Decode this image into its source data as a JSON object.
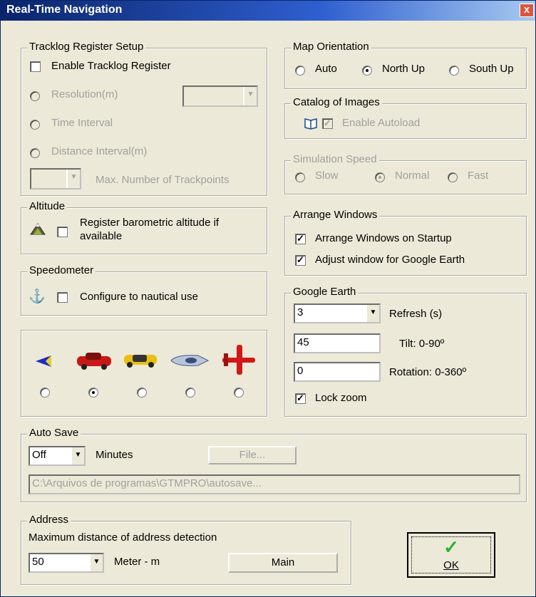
{
  "window": {
    "title": "Real-Time Navigation",
    "close_glyph": "x"
  },
  "tracklog": {
    "legend": "Tracklog Register Setup",
    "enable_label": "Enable Tracklog Register",
    "enable_checked": false,
    "resolution_label": "Resolution(m)",
    "time_interval_label": "Time Interval",
    "distance_interval_label": "Distance Interval(m)",
    "max_points_label": "Max. Number of Trackpoints"
  },
  "altitude": {
    "legend": "Altitude",
    "icon": "mountain-icon",
    "label_line1": "Register barometric altitude if",
    "label_line2": "available",
    "checked": false
  },
  "speedometer": {
    "legend": "Speedometer",
    "icon": "anchor-icon",
    "label": "Configure to nautical use",
    "checked": false
  },
  "vehicles": {
    "icons": [
      "arrow-cursor-icon",
      "red-car-icon",
      "yellow-car-icon",
      "boat-icon",
      "airplane-icon"
    ],
    "selected_index": 1
  },
  "map_orientation": {
    "legend": "Map Orientation",
    "options": [
      "Auto",
      "North Up",
      "South Up"
    ],
    "selected": "North Up"
  },
  "catalog": {
    "legend": "Catalog of Images",
    "icon": "book-icon",
    "label": "Enable Autoload",
    "checked": true
  },
  "simulation": {
    "legend": "Simulation Speed",
    "options": [
      "Slow",
      "Normal",
      "Fast"
    ],
    "selected": "Normal"
  },
  "arrange": {
    "legend": "Arrange Windows",
    "startup_label": "Arrange Windows on Startup",
    "startup_checked": true,
    "adjust_label": "Adjust window for Google Earth",
    "adjust_checked": true
  },
  "google_earth": {
    "legend": "Google Earth",
    "refresh_value": "3",
    "refresh_label": "Refresh (s)",
    "tilt_value": "45",
    "tilt_label": "Tilt: 0-90º",
    "rotation_value": "0",
    "rotation_label": "Rotation:  0-360º",
    "lock_zoom_label": "Lock zoom",
    "lock_zoom_checked": true
  },
  "auto_save": {
    "legend": "Auto Save",
    "interval_value": "Off",
    "minutes_label": "Minutes",
    "file_button": "File...",
    "path": "C:\\Arquivos de programas\\GTMPRO\\autosave..."
  },
  "address": {
    "legend": "Address",
    "description": "Maximum distance of address detection",
    "distance_value": "50",
    "unit_label": "Meter - m",
    "main_button": "Main"
  },
  "ok_button": {
    "label": "OK",
    "check_glyph": "✓"
  },
  "colors": {
    "title_start": "#0A246A",
    "face": "#ECE9D8",
    "disabled_text": "#A0A0A0",
    "check_green": "#2BB52B"
  }
}
